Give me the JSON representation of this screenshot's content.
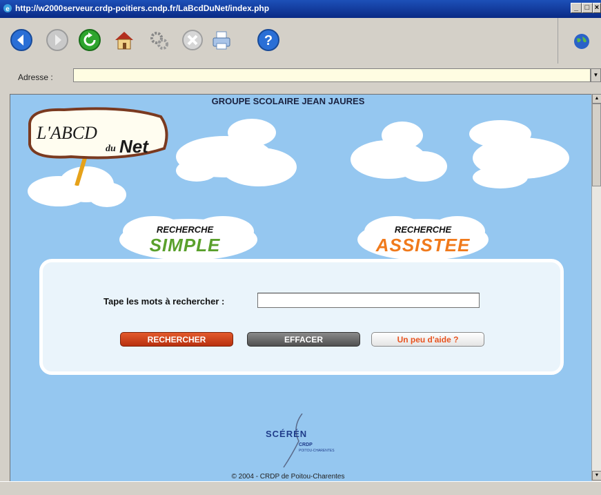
{
  "window": {
    "title": "http://w2000serveur.crdp-poitiers.cndp.fr/LaBcdDuNet/index.php",
    "controls": {
      "minimize": "_",
      "maximize": "□",
      "close": "×"
    }
  },
  "toolbar": {
    "buttons": [
      {
        "name": "back",
        "icon": "back-arrow-icon"
      },
      {
        "name": "forward",
        "icon": "forward-arrow-icon"
      },
      {
        "name": "refresh",
        "icon": "refresh-icon"
      },
      {
        "name": "home",
        "icon": "home-icon"
      },
      {
        "name": "settings",
        "icon": "gears-icon"
      },
      {
        "name": "stop",
        "icon": "stop-icon"
      },
      {
        "name": "print",
        "icon": "printer-icon"
      },
      {
        "name": "help",
        "icon": "help-icon"
      }
    ],
    "throbber_icon": "globe-icon"
  },
  "addressbar": {
    "label": "Adresse :",
    "value": ""
  },
  "page": {
    "school_title": "GROUPE SCOLAIRE JEAN JAURES",
    "logo": {
      "line1": "L'ABCD",
      "line2": "du",
      "line3": "Net"
    },
    "tabs": [
      {
        "top": "RECHERCHE",
        "bottom": "SIMPLE",
        "color": "#5aa02c"
      },
      {
        "top": "RECHERCHE",
        "bottom": "ASSISTEE",
        "color": "#f07a1c"
      }
    ],
    "search": {
      "label": "Tape les mots à rechercher :",
      "value": "",
      "buttons": {
        "search": "RECHERCHER",
        "clear": "EFFACER",
        "help": "Un peu d'aide ?"
      }
    },
    "footer_logo": {
      "name": "SCÉRÉN",
      "line1": "CRDP",
      "line2": "POITOU-CHARENTES"
    },
    "copyright": "© 2004 - CRDP de Poitou-Charentes"
  },
  "colors": {
    "page_bg": "#95c7f0",
    "accent_orange": "#e35a2c",
    "accent_green": "#5aa02c"
  }
}
